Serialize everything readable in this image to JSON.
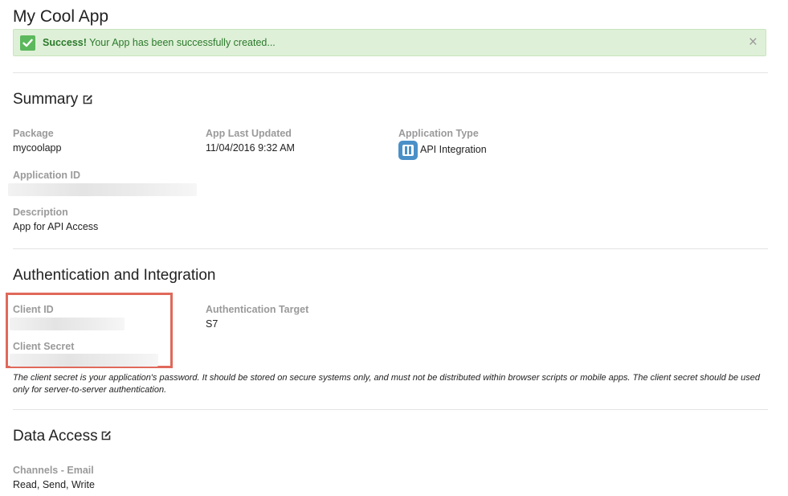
{
  "app": {
    "title": "My Cool App"
  },
  "alert": {
    "strong": "Success!",
    "text": " Your App has been successfully created...",
    "close_glyph": "×"
  },
  "summary": {
    "title": "Summary",
    "edit_icon": "edit-icon",
    "package": {
      "label": "Package",
      "value": "mycoolapp"
    },
    "last_updated": {
      "label": "App Last Updated",
      "value": "11/04/2016 9:32 AM"
    },
    "app_type": {
      "label": "Application Type",
      "value": "API Integration",
      "icon": "api-integration-icon"
    },
    "application_id": {
      "label": "Application ID"
    },
    "description": {
      "label": "Description",
      "value": "App for API Access"
    }
  },
  "auth": {
    "title": "Authentication and Integration",
    "client_id": {
      "label": "Client ID"
    },
    "client_secret": {
      "label": "Client Secret"
    },
    "target": {
      "label": "Authentication Target",
      "value": "S7"
    },
    "note": "The client secret is your application's password. It should be stored on secure systems only, and must not be distributed within browser scripts or mobile apps. The client secret should be used only for server-to-server authentication.",
    "highlight_color": "#e0695a"
  },
  "data_access": {
    "title": "Data Access",
    "edit_icon": "edit-icon",
    "channels_email": {
      "label": "Channels - Email",
      "value": "Read, Send, Write"
    }
  },
  "colors": {
    "success_bg": "#dff0d8",
    "success_text": "#2b7a2b",
    "label_gray": "#9a9a9a",
    "accent_blue": "#4a90c8"
  }
}
